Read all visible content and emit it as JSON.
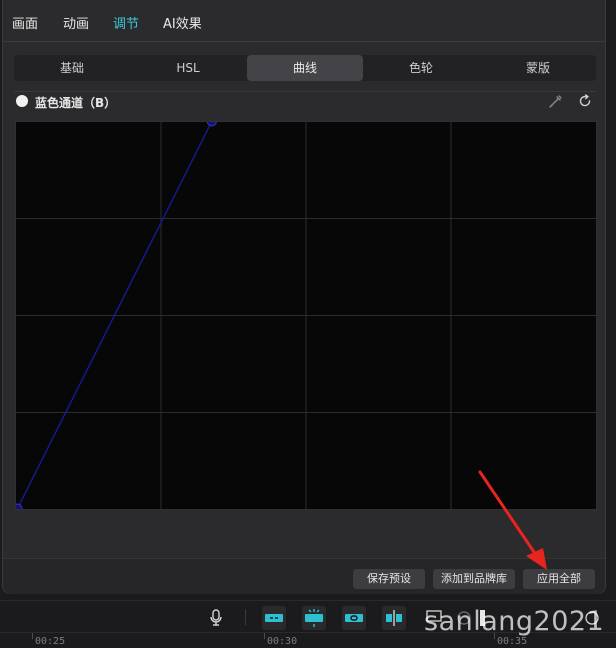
{
  "top_tabs": [
    {
      "label": "画面"
    },
    {
      "label": "动画"
    },
    {
      "label": "调节",
      "active": true
    },
    {
      "label": "AI效果"
    }
  ],
  "sub_tabs": [
    {
      "label": "基础"
    },
    {
      "label": "HSL"
    },
    {
      "label": "曲线",
      "active": true
    },
    {
      "label": "色轮"
    },
    {
      "label": "蒙版"
    }
  ],
  "channel": {
    "label": "蓝色通道（B）",
    "icons": [
      "color-picker-icon",
      "reset-icon"
    ]
  },
  "curve": {
    "channel": "blue",
    "line_color": "#1a1a9a",
    "point_color": "#12127a",
    "points": [
      [
        0,
        0
      ],
      [
        0.335,
        1.0
      ]
    ]
  },
  "actions": {
    "save_preset": "保存预设",
    "add_brand_library": "添加到品牌库",
    "apply_all": "应用全部"
  },
  "timeline": {
    "ticks": [
      "00:25",
      "00:30",
      "00:35"
    ],
    "icons": [
      "microphone-icon",
      "link-clip-icon",
      "split-clip-icon",
      "link-track-icon",
      "align-center-icon",
      "preview-axis-icon",
      "zoom-icon"
    ]
  },
  "watermark": "sanlang2021",
  "colors": {
    "accent": "#3ec8d8",
    "annotation_arrow": "#e8241e"
  }
}
